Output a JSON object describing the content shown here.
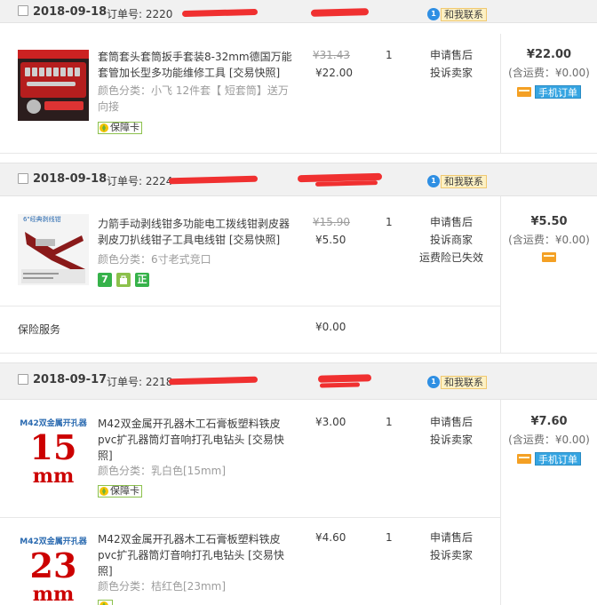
{
  "orders": [
    {
      "date": "2018-09-18",
      "order_no": "订单号: 2220",
      "shop": "",
      "contact": "和我联系",
      "contact_badge": "1",
      "total": "¥22.00",
      "shipping": "(含运费：¥0.00)",
      "mobile_order": "手机订单",
      "items": [
        {
          "title": "套筒套头套筒扳手套装8-32mm德国万能套管加长型多功能维修工具 [交易快照]",
          "sku": "颜色分类：小飞 12件套【 短套筒】送万向接",
          "badge": "保障卡",
          "price_orig": "¥31.43",
          "price_now": "¥22.00",
          "qty": "1",
          "ops": [
            "申请售后",
            "投诉卖家"
          ]
        }
      ]
    },
    {
      "date": "2018-09-18",
      "order_no": "订单号: 2224",
      "shop": "",
      "contact": "和我联系",
      "contact_badge": "1",
      "total": "¥5.50",
      "shipping": "(含运费：¥0.00)",
      "items": [
        {
          "title": "力箭手动剥线钳多功能电工拨线钳剥皮器剥皮刀扒线钳子工具电线钳 [交易快照]",
          "sku": "颜色分类：6寸老式竞口",
          "price_orig": "¥15.90",
          "price_now": "¥5.50",
          "qty": "1",
          "ops": [
            "申请售后",
            "投诉商家",
            "运费险已失效"
          ],
          "thumb_text": "6\"经典剥线钳"
        }
      ],
      "insurance": {
        "label": "保险服务",
        "price": "¥0.00"
      }
    },
    {
      "date": "2018-09-17",
      "order_no": "订单号: 2218",
      "shop": "",
      "contact": "和我联系",
      "contact_badge": "1",
      "total": "¥7.60",
      "shipping": "(含运费：¥0.00)",
      "mobile_order": "手机订单",
      "items": [
        {
          "title": "M42双金属开孔器木工石膏板塑料铁皮pvc扩孔器筒灯音响打孔电钻头 [交易快照]",
          "sku": "颜色分类：乳白色[15mm]",
          "badge": "保障卡",
          "price_now": "¥3.00",
          "qty": "1",
          "ops": [
            "申请售后",
            "投诉卖家"
          ],
          "thumb_caption": "M42双金属开孔器",
          "thumb_num": "15",
          "thumb_unit": "mm"
        },
        {
          "title": "M42双金属开孔器木工石膏板塑料铁皮pvc扩孔器筒灯音响打孔电钻头 [交易快照]",
          "sku": "颜色分类：桔红色[23mm]",
          "price_now": "¥4.60",
          "qty": "1",
          "ops": [
            "申请售后",
            "投诉卖家"
          ],
          "thumb_caption": "M42双金属开孔器",
          "thumb_num": "23",
          "thumb_unit": "mm"
        }
      ]
    }
  ],
  "colors": {
    "header_bg": "#f1f1f1",
    "redaction": "#f03030",
    "accent_blue": "#36a5e2",
    "thumb_red": "#cc0000",
    "badge_green": "#8cc14c"
  }
}
